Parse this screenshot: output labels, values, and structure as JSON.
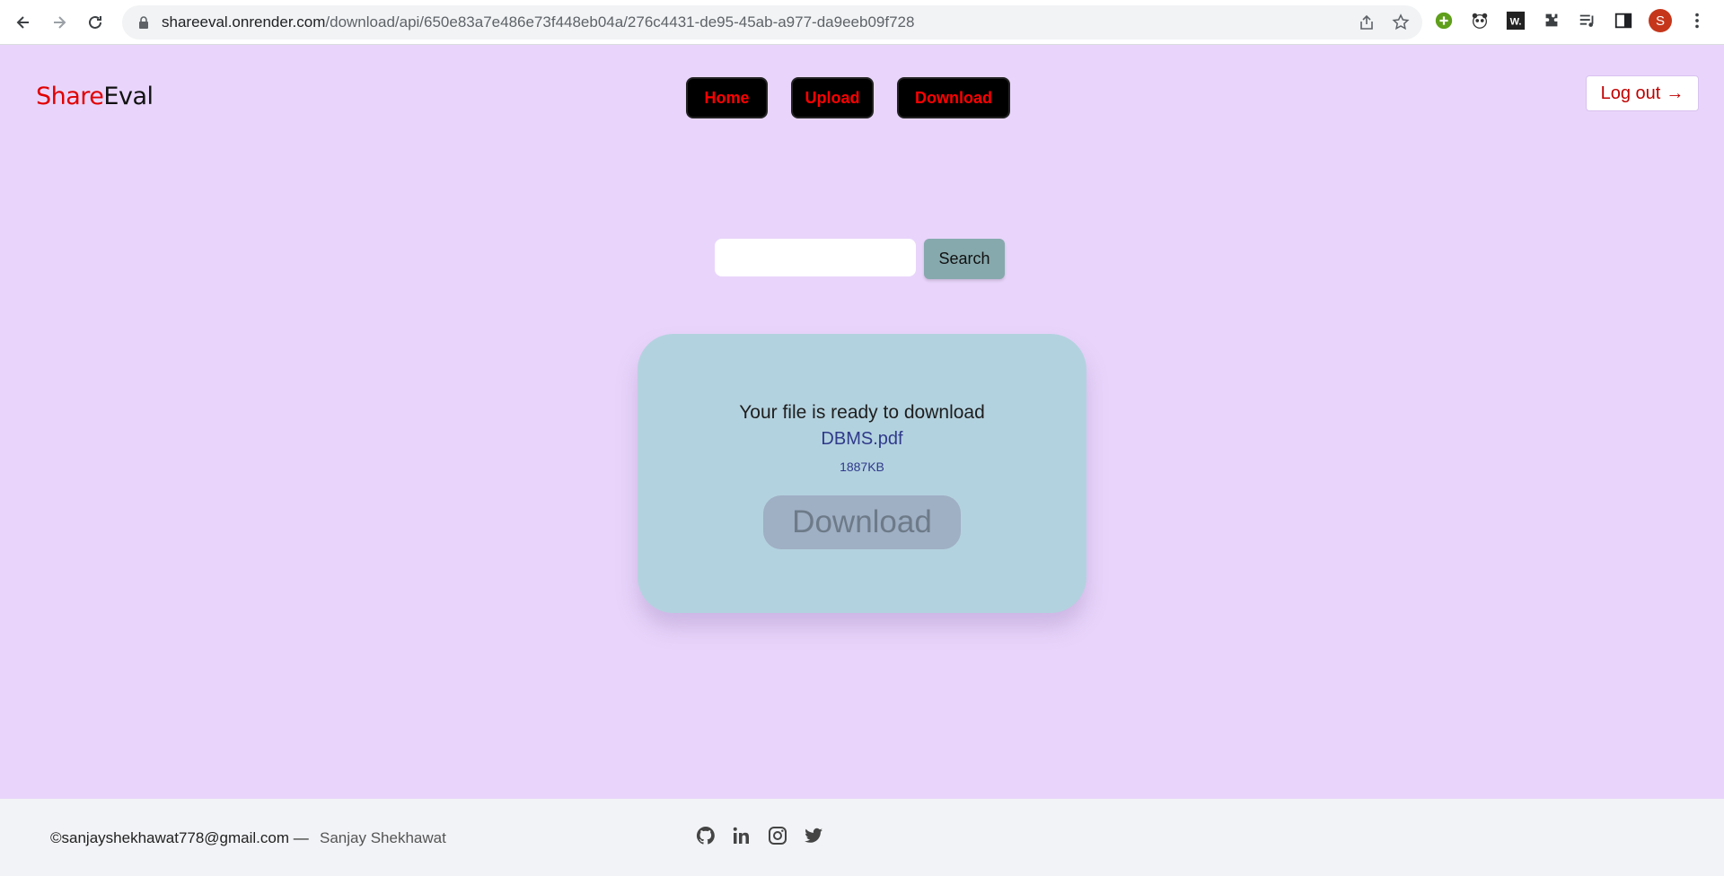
{
  "browser": {
    "url_host": "shareeval.onrender.com",
    "url_path": "/download/api/650e83a7e486e73f448eb04a/276c4431-de95-45ab-a977-da9eeb09f728",
    "avatar_letter": "S"
  },
  "header": {
    "logo_part1": "Share",
    "logo_part2": "Eval",
    "nav": [
      {
        "label": "Home"
      },
      {
        "label": "Upload"
      },
      {
        "label": "Download"
      }
    ],
    "logout_label": "Log out",
    "logout_arrow": "→"
  },
  "search": {
    "placeholder": "",
    "button_label": "Search"
  },
  "card": {
    "message": "Your file is ready to download",
    "file_name": "DBMS.pdf",
    "file_size": "1887KB",
    "download_label": "Download"
  },
  "footer": {
    "email": "©sanjayshekhawat778@gmail.com —",
    "author": "Sanjay Shekhawat",
    "socials": [
      "github-icon",
      "linkedin-icon",
      "instagram-icon",
      "twitter-icon"
    ]
  },
  "colors": {
    "page_bg": "#e9d5fb",
    "accent_red": "#ff0000",
    "card_bg": "#b3d2df",
    "search_button": "#86a9ad"
  }
}
